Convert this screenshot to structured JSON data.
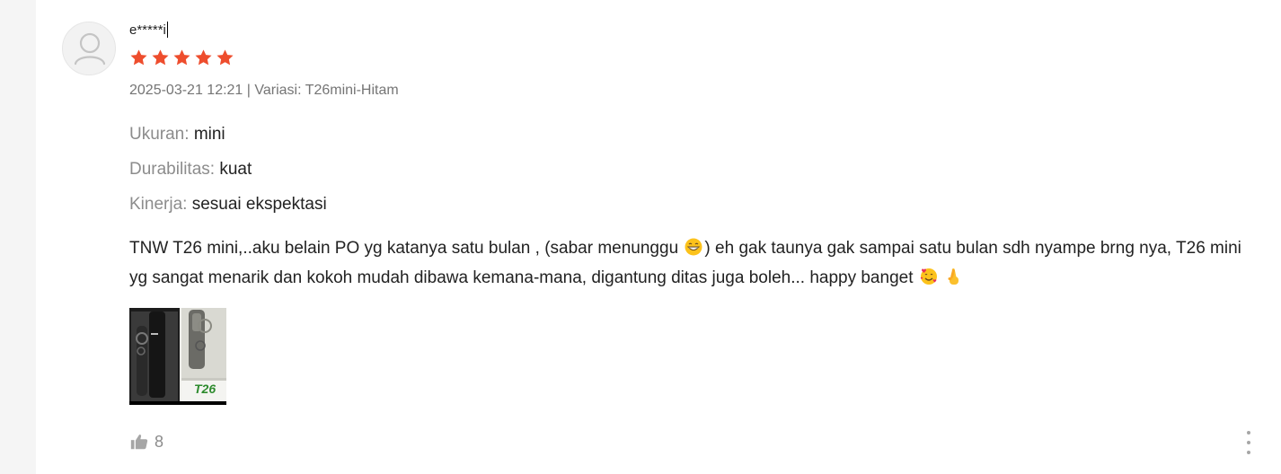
{
  "review": {
    "username": "e*****i",
    "rating": 5,
    "rating_max": 5,
    "meta": "2025-03-21 12:21 | Variasi: T26mini-Hitam",
    "attributes": [
      {
        "key": "Ukuran:",
        "value": "mini"
      },
      {
        "key": "Durabilitas:",
        "value": "kuat"
      },
      {
        "key": "Kinerja:",
        "value": "sesuai ekspektasi"
      }
    ],
    "text_part1": "TNW T26 mini,..aku belain PO yg katanya satu bulan , (sabar menunggu",
    "text_part2": ") eh gak taunya gak sampai satu bulan sdh nyampe brng nya, T26 mini yg sangat menarik dan kokoh mudah dibawa kemana-mana, digantung ditas juga boleh... happy banget",
    "media": {
      "image_label": "T26"
    },
    "likes": "8"
  },
  "icons": {
    "avatar": "user-avatar-placeholder-icon",
    "star": "star-icon",
    "like": "thumbs-up-icon",
    "more": "more-vertical-icon",
    "emoji_1": "grinning-face-emoji",
    "emoji_2": "smiling-face-with-hearts-emoji",
    "emoji_3": "crossed-fingers-emoji"
  },
  "colors": {
    "star": "#ee4d2d",
    "muted_text": "#757575",
    "attr_key": "#8c8c8c",
    "body_text": "#222222"
  }
}
